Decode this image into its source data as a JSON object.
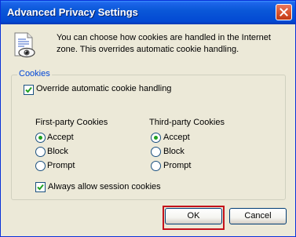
{
  "window": {
    "title": "Advanced Privacy Settings"
  },
  "info": {
    "text": "You can choose how cookies are handled in the Internet zone.  This overrides automatic cookie handling."
  },
  "cookies": {
    "group_label": "Cookies",
    "override_label": "Override automatic cookie handling",
    "override_checked": true,
    "first_party": {
      "heading": "First-party Cookies",
      "options": [
        "Accept",
        "Block",
        "Prompt"
      ],
      "selected": "Accept"
    },
    "third_party": {
      "heading": "Third-party Cookies",
      "options": [
        "Accept",
        "Block",
        "Prompt"
      ],
      "selected": "Accept"
    },
    "session_label": "Always allow session cookies",
    "session_checked": true
  },
  "buttons": {
    "ok": "OK",
    "cancel": "Cancel"
  },
  "colors": {
    "highlight_outline": "#c4121a",
    "group_label": "#0046d5",
    "radio_dot": "#21a121"
  }
}
